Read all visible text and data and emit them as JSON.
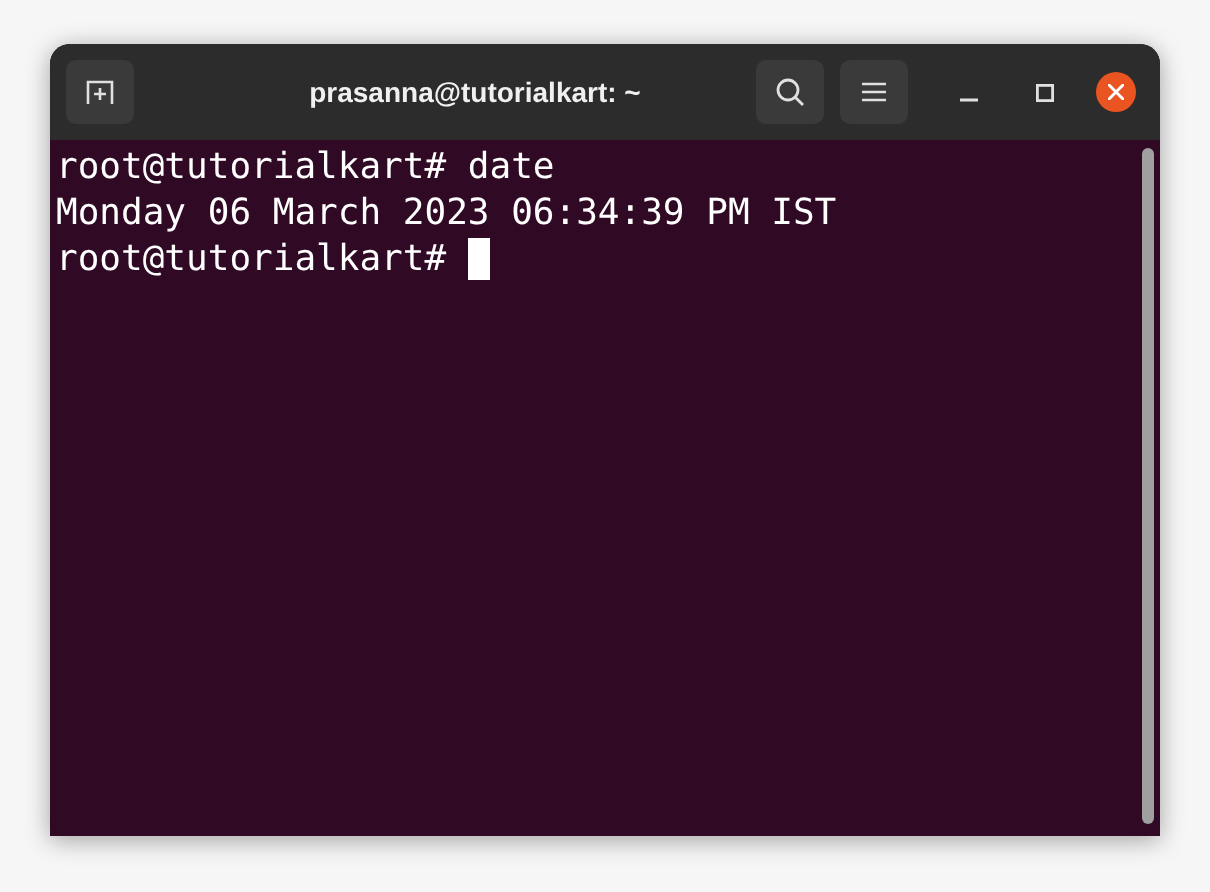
{
  "window": {
    "title": "prasanna@tutorialkart: ~"
  },
  "terminal": {
    "lines": [
      {
        "kind": "prompt",
        "prompt": "root@tutorialkart#",
        "command": "date"
      },
      {
        "kind": "output",
        "text": "Monday 06 March 2023 06:34:39 PM IST"
      },
      {
        "kind": "prompt",
        "prompt": "root@tutorialkart#",
        "cursor": true
      }
    ]
  }
}
